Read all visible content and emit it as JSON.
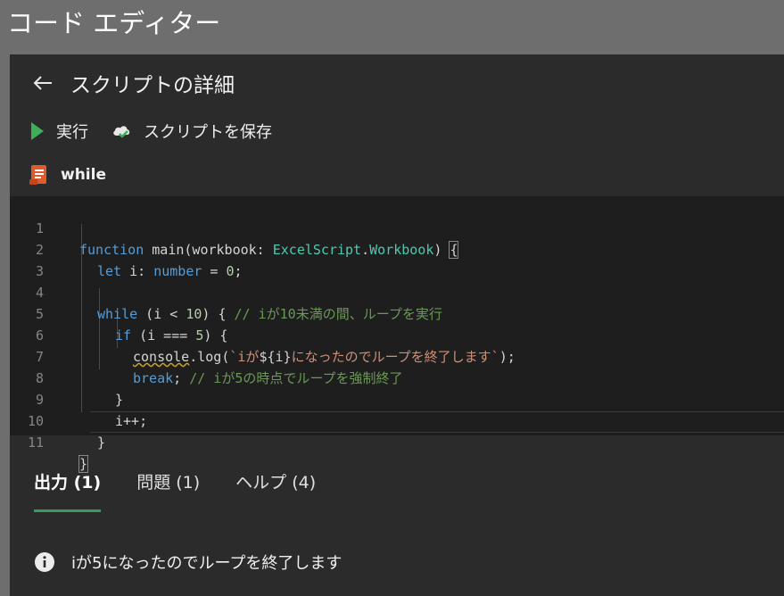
{
  "app_title": "コード エディター",
  "header": {
    "title": "スクリプトの詳細"
  },
  "toolbar": {
    "run_label": "実行",
    "save_label": "スクリプトを保存"
  },
  "file": {
    "name": "while"
  },
  "code": {
    "line_numbers": [
      "1",
      "2",
      "3",
      "4",
      "5",
      "6",
      "7",
      "8",
      "9",
      "10",
      "11"
    ],
    "tokens": {
      "l1_function": "function",
      "l1_main": " main(workbook: ",
      "l1_type1": "ExcelScript",
      "l1_dot": ".",
      "l1_type2": "Workbook",
      "l1_close": ") ",
      "l1_brace": "{",
      "l2_let": "let",
      "l2_i": " i: ",
      "l2_number": "number",
      "l2_eq": " = ",
      "l2_zero": "0",
      "l2_semi": ";",
      "l4_while": "while",
      "l4_cond": " (i < ",
      "l4_ten": "10",
      "l4_rest": ") { ",
      "l4_comment": "// iが10未満の間、ループを実行",
      "l5_if": "if",
      "l5_cond": " (i === ",
      "l5_five": "5",
      "l5_rest": ") {",
      "l6_console": "console",
      "l6_log": ".log(",
      "l6_str1": "`iが",
      "l6_interp": "${i}",
      "l6_str2": "になったのでループを終了します`",
      "l6_end": ");",
      "l7_break": "break",
      "l7_semi": "; ",
      "l7_comment": "// iが5の時点でループを強制終了",
      "l8_brace": "}",
      "l9_inc": "i++;",
      "l10_brace": "}",
      "l11_brace": "}"
    }
  },
  "tabs": [
    {
      "label": "出力 (1)",
      "active": true
    },
    {
      "label": "問題 (1)",
      "active": false
    },
    {
      "label": "ヘルプ (4)",
      "active": false
    }
  ],
  "output": {
    "message": "iが5になったのでループを終了します"
  },
  "colors": {
    "accent_green": "#3a9a5a",
    "file_icon": "#e05a2b",
    "run_icon": "#3fae5a"
  }
}
